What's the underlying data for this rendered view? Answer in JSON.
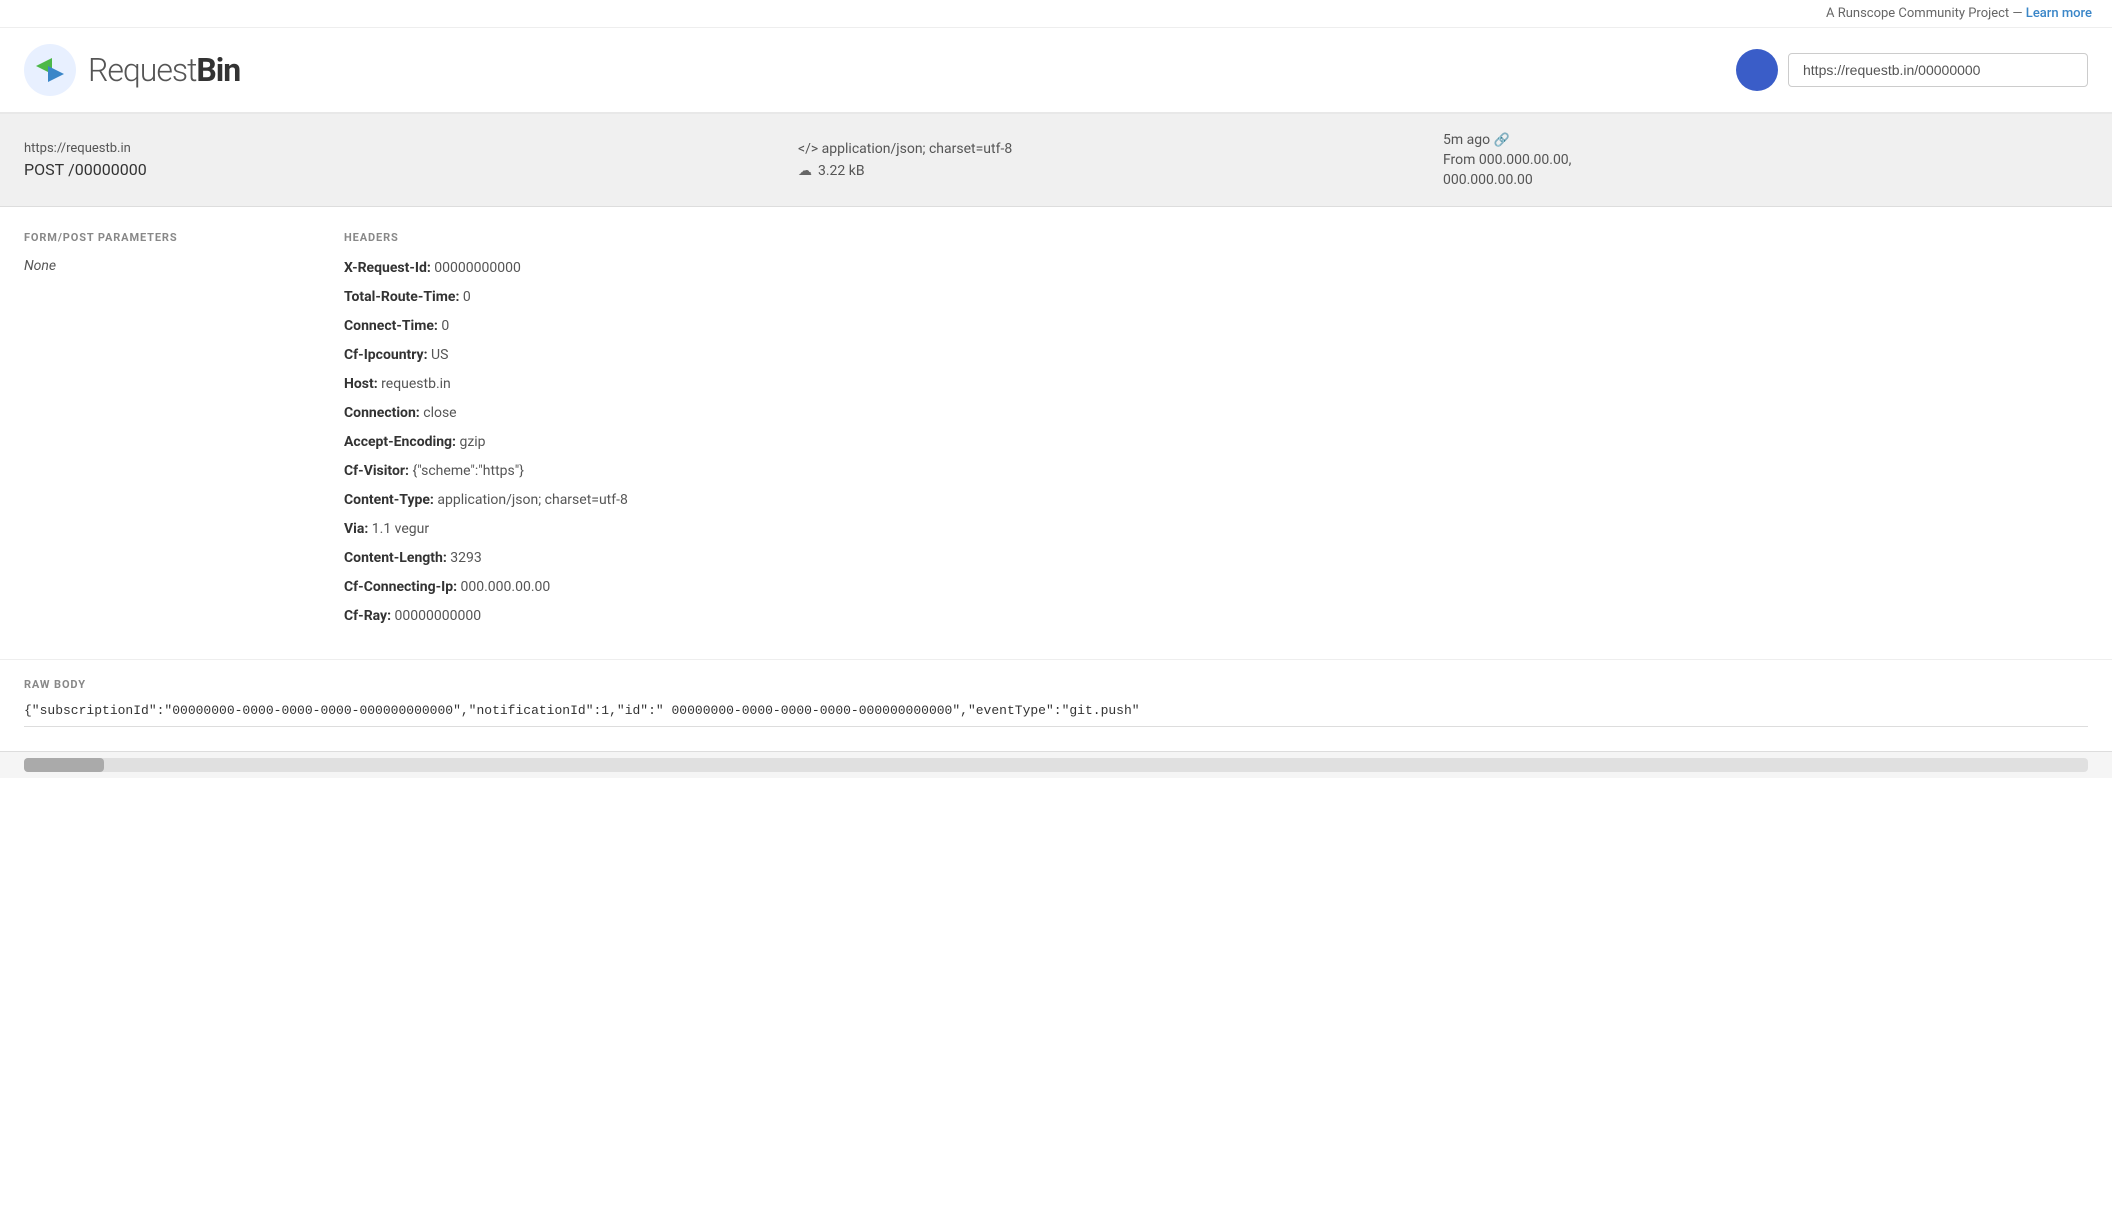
{
  "banner": {
    "text": "A Runscope Community Project — ",
    "link_text": "Learn more",
    "link_url": "#"
  },
  "header": {
    "logo_text_plain": "Request",
    "logo_text_bold": "Bin",
    "url_value": "https://requestb.in/00000000"
  },
  "request_summary": {
    "url": "https://requestb.in",
    "method": "POST",
    "path": "/00000000",
    "content_type": "</> application/json; charset=utf-8",
    "size": "3.22 kB",
    "time_ago": "5m ago",
    "from_label": "From",
    "from_ip_line1": "000.000.00.00,",
    "from_ip_line2": "000.000.00.00"
  },
  "form_post": {
    "section_title": "FORM/POST PARAMETERS",
    "value": "None"
  },
  "headers": {
    "section_title": "HEADERS",
    "items": [
      {
        "key": "X-Request-Id:",
        "value": "00000000000"
      },
      {
        "key": "Total-Route-Time:",
        "value": "0"
      },
      {
        "key": "Connect-Time:",
        "value": "0"
      },
      {
        "key": "Cf-Ipcountry:",
        "value": "US"
      },
      {
        "key": "Host:",
        "value": "requestb.in"
      },
      {
        "key": "Connection:",
        "value": "close"
      },
      {
        "key": "Accept-Encoding:",
        "value": "gzip"
      },
      {
        "key": "Cf-Visitor:",
        "value": "{\"scheme\":\"https\"}"
      },
      {
        "key": "Content-Type:",
        "value": "application/json; charset=utf-8"
      },
      {
        "key": "Via:",
        "value": "1.1 vegur"
      },
      {
        "key": "Content-Length:",
        "value": "3293"
      },
      {
        "key": "Cf-Connecting-Ip:",
        "value": "000.000.00.00"
      },
      {
        "key": "Cf-Ray:",
        "value": "00000000000"
      }
    ]
  },
  "raw_body": {
    "section_title": "RAW BODY",
    "content": "{\"subscriptionId\":\"00000000-0000-0000-0000-000000000000\",\"notificationId\":1,\"id\":\" 00000000-0000-0000-0000-000000000000\",\"eventType\":\"git.push\""
  }
}
